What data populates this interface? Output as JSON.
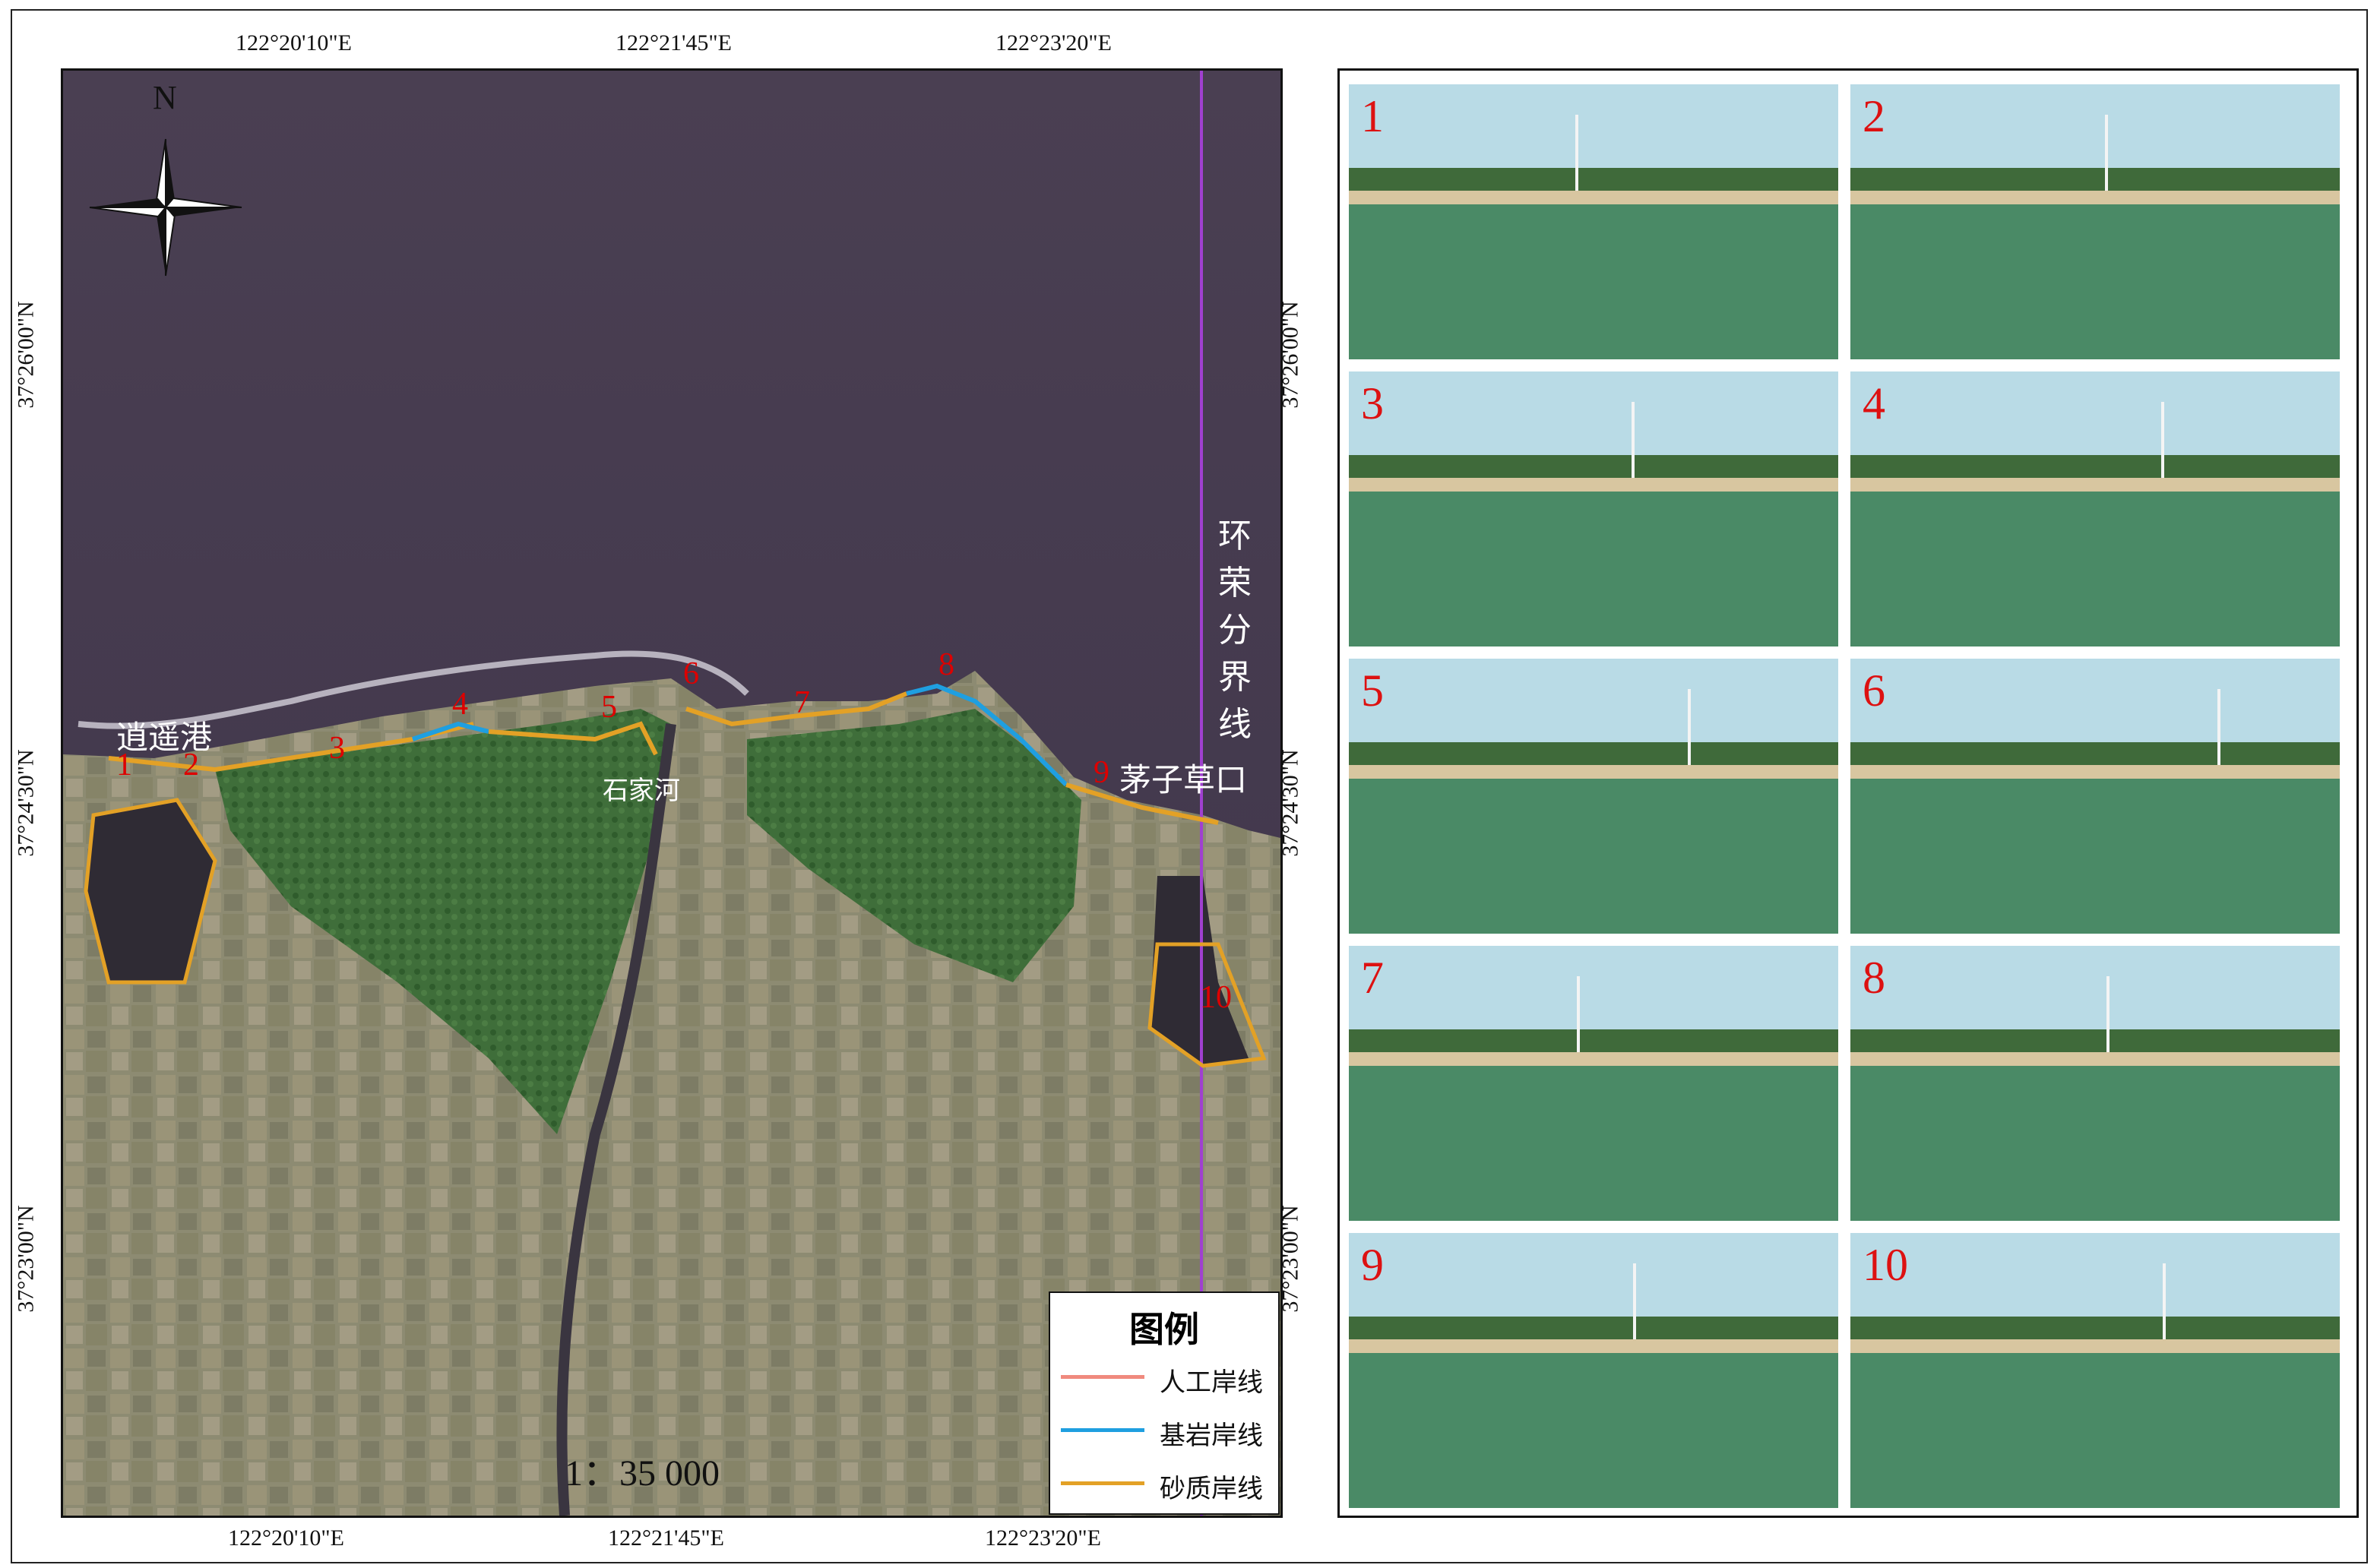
{
  "map": {
    "top_lon": [
      "122°20'10\"E",
      "122°21'45\"E",
      "122°23'20\"E"
    ],
    "bottom_lon": [
      "122°20'10\"E",
      "122°21'45\"E",
      "122°23'20\"E"
    ],
    "left_lat": [
      "37°26'00\"N",
      "37°24'30\"N",
      "37°23'00\"N"
    ],
    "right_lat": [
      "37°26'00\"N",
      "37°24'30\"N",
      "37°23'00\"N"
    ],
    "north": "N",
    "scale": "1：35 000",
    "boundary_label": "环荣分界线",
    "place_labels": [
      "逍遥港",
      "石家河",
      "茅子草口"
    ],
    "site_numbers": [
      "1",
      "2",
      "3",
      "4",
      "5",
      "6",
      "7",
      "8",
      "9",
      "10"
    ],
    "colors": {
      "artificial": "#f08a7e",
      "bedrock": "#1f9fe0",
      "sandy": "#e3a126",
      "boundary": "#a040d0"
    }
  },
  "legend": {
    "title": "图例",
    "items": [
      {
        "label": "人工岸线",
        "color": "#f08a7e"
      },
      {
        "label": "基岩岸线",
        "color": "#1f9fe0"
      },
      {
        "label": "砂质岸线",
        "color": "#e3a126"
      }
    ]
  },
  "photos": [
    "1",
    "2",
    "3",
    "4",
    "5",
    "6",
    "7",
    "8",
    "9",
    "10"
  ]
}
